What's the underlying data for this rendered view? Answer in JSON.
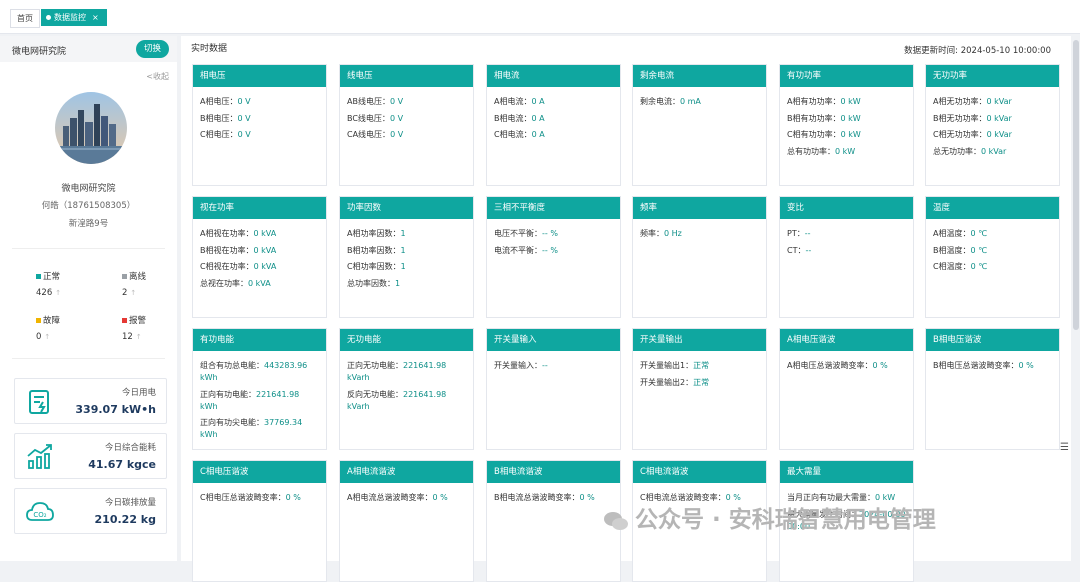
{
  "tabs": {
    "home": "首页",
    "active": "数据监控",
    "close": "×"
  },
  "sidebar": {
    "org": "微电网研究院",
    "switch_label": "切换",
    "collapse_label": "<收起",
    "profile": {
      "name": "微电网研究院",
      "phone": "何皓（18761508305）",
      "address": "新湟路9号"
    },
    "stats": [
      {
        "label": "正常",
        "value": "426",
        "color": "#0fa7a0"
      },
      {
        "label": "离线",
        "value": "2",
        "color": "#9aa0a6"
      },
      {
        "label": "故障",
        "value": "0",
        "color": "#f0b400"
      },
      {
        "label": "报警",
        "value": "12",
        "color": "#e53935"
      }
    ],
    "stat_arrow": "↑",
    "kpis": [
      {
        "label": "今日用电",
        "value": "339.07 kW•h",
        "icon": "electricity-report-icon"
      },
      {
        "label": "今日综合能耗",
        "value": "41.67 kgce",
        "icon": "energy-trend-icon"
      },
      {
        "label": "今日碳排放量",
        "value": "210.22 kg",
        "icon": "co2-cloud-icon"
      }
    ]
  },
  "main": {
    "title": "实时数据",
    "update_time": "数据更新时间: 2024-05-10 10:00:00",
    "cards": [
      {
        "title": "相电压",
        "rows": [
          [
            "A相电压：",
            "0 V"
          ],
          [
            "B相电压：",
            "0 V"
          ],
          [
            "C相电压：",
            "0 V"
          ]
        ]
      },
      {
        "title": "线电压",
        "rows": [
          [
            "AB线电压：",
            "0 V"
          ],
          [
            "BC线电压：",
            "0 V"
          ],
          [
            "CA线电压：",
            "0 V"
          ]
        ]
      },
      {
        "title": "相电流",
        "rows": [
          [
            "A相电流：",
            "0 A"
          ],
          [
            "B相电流：",
            "0 A"
          ],
          [
            "C相电流：",
            "0 A"
          ]
        ]
      },
      {
        "title": "剩余电流",
        "rows": [
          [
            "剩余电流：",
            "0 mA"
          ]
        ]
      },
      {
        "title": "有功功率",
        "rows": [
          [
            "A相有功功率：",
            "0 kW"
          ],
          [
            "B相有功功率：",
            "0 kW"
          ],
          [
            "C相有功功率：",
            "0 kW"
          ],
          [
            "总有功功率：",
            "0 kW"
          ]
        ]
      },
      {
        "title": "无功功率",
        "rows": [
          [
            "A相无功功率：",
            "0 kVar"
          ],
          [
            "B相无功功率：",
            "0 kVar"
          ],
          [
            "C相无功功率：",
            "0 kVar"
          ],
          [
            "总无功功率：",
            "0 kVar"
          ]
        ]
      },
      {
        "title": "视在功率",
        "rows": [
          [
            "A相视在功率：",
            "0 kVA"
          ],
          [
            "B相视在功率：",
            "0 kVA"
          ],
          [
            "C相视在功率：",
            "0 kVA"
          ],
          [
            "总视在功率：",
            "0 kVA"
          ]
        ]
      },
      {
        "title": "功率因数",
        "rows": [
          [
            "A相功率因数：",
            "1"
          ],
          [
            "B相功率因数：",
            "1"
          ],
          [
            "C相功率因数：",
            "1"
          ],
          [
            "总功率因数：",
            "1"
          ]
        ]
      },
      {
        "title": "三相不平衡度",
        "rows": [
          [
            "电压不平衡：",
            "-- %"
          ],
          [
            "电流不平衡：",
            "-- %"
          ]
        ]
      },
      {
        "title": "频率",
        "rows": [
          [
            "频率：",
            "0 Hz"
          ]
        ]
      },
      {
        "title": "变比",
        "rows": [
          [
            "PT：",
            "--"
          ],
          [
            "CT：",
            "--"
          ]
        ]
      },
      {
        "title": "温度",
        "rows": [
          [
            "A相温度：",
            "0 ℃"
          ],
          [
            "B相温度：",
            "0 ℃"
          ],
          [
            "C相温度：",
            "0 ℃"
          ]
        ]
      },
      {
        "title": "有功电能",
        "rows": [
          [
            "组合有功总电能：",
            "443283.96 kWh"
          ],
          [
            "正向有功电能：",
            "221641.98 kWh"
          ],
          [
            "正向有功尖电能：",
            "37769.34 kWh"
          ]
        ]
      },
      {
        "title": "无功电能",
        "rows": [
          [
            "正向无功电能：",
            "221641.98 kVarh"
          ],
          [
            "反向无功电能：",
            "221641.98 kVarh"
          ]
        ]
      },
      {
        "title": "开关量输入",
        "rows": [
          [
            "开关量输入：",
            "--"
          ]
        ]
      },
      {
        "title": "开关量输出",
        "rows": [
          [
            "开关量输出1：",
            "正常"
          ],
          [
            "开关量输出2：",
            "正常"
          ]
        ]
      },
      {
        "title": "A相电压谐波",
        "rows": [
          [
            "A相电压总谐波畸变率：",
            "0 %"
          ]
        ]
      },
      {
        "title": "B相电压谐波",
        "rows": [
          [
            "B相电压总谐波畸变率：",
            "0 %"
          ]
        ]
      },
      {
        "title": "C相电压谐波",
        "rows": [
          [
            "C相电压总谐波畸变率：",
            "0 %"
          ]
        ]
      },
      {
        "title": "A相电流谐波",
        "rows": [
          [
            "A相电流总谐波畸变率：",
            "0 %"
          ]
        ]
      },
      {
        "title": "B相电流谐波",
        "rows": [
          [
            "B相电流总谐波畸变率：",
            "0 %"
          ]
        ]
      },
      {
        "title": "C相电流谐波",
        "rows": [
          [
            "C相电流总谐波畸变率：",
            "0 %"
          ]
        ]
      },
      {
        "title": "最大需量",
        "rows": [
          [
            "当月正向有功最大需量：",
            "0 kW"
          ],
          [
            "最大需量发生时间：",
            "2024-00-00 00:00"
          ]
        ]
      }
    ]
  },
  "watermark": "公众号 · 安科瑞智慧用电管理",
  "colors": {
    "accent": "#0fa7a0",
    "value": "#0e8f88"
  }
}
